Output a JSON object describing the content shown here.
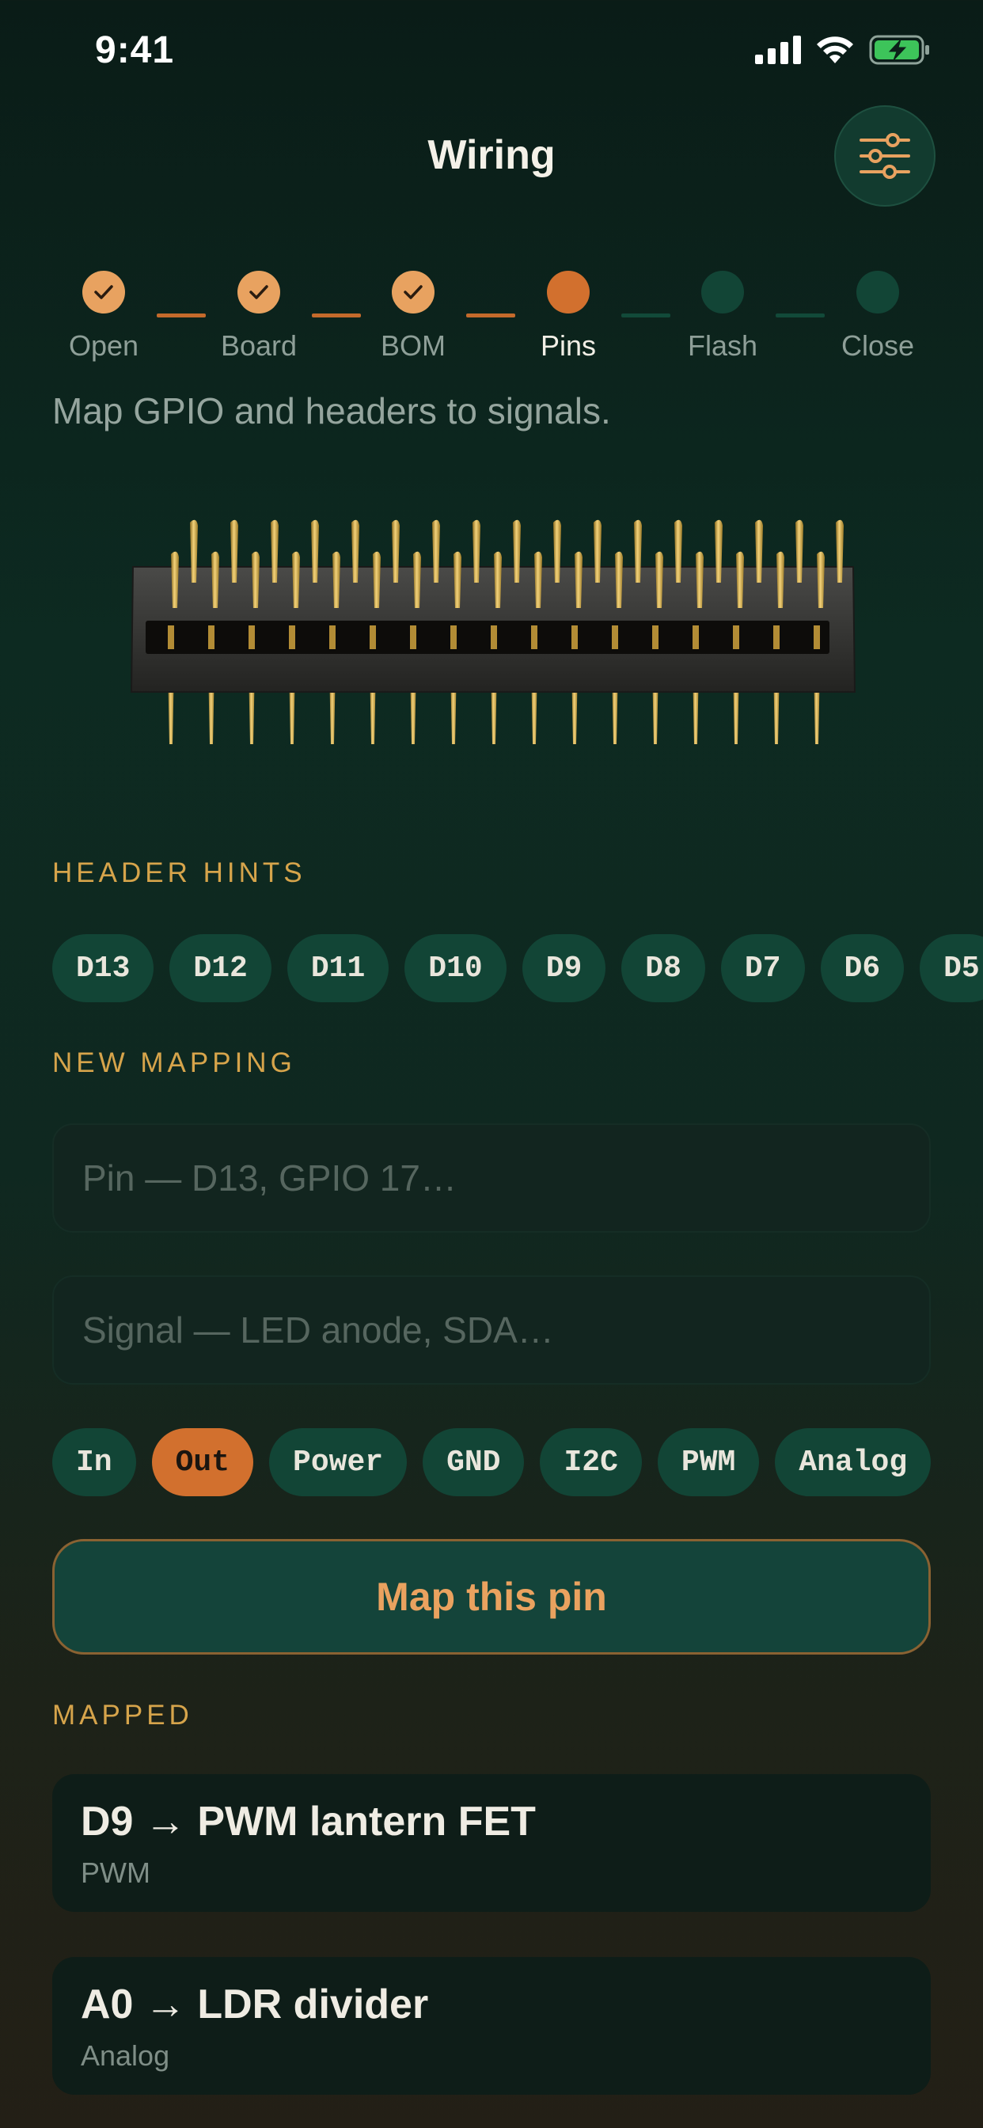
{
  "status_bar": {
    "time": "9:41",
    "icons": [
      "signal-icon",
      "wifi-icon",
      "battery-charging-icon"
    ]
  },
  "nav": {
    "title": "Wiring",
    "settings_icon": "sliders-icon"
  },
  "steps": [
    {
      "label": "Open",
      "state": "done"
    },
    {
      "label": "Board",
      "state": "done"
    },
    {
      "label": "BOM",
      "state": "done"
    },
    {
      "label": "Pins",
      "state": "current"
    },
    {
      "label": "Flash",
      "state": "todo"
    },
    {
      "label": "Close",
      "state": "todo"
    }
  ],
  "subtitle": "Map GPIO and headers to signals.",
  "header_hints": {
    "label": "HEADER HINTS",
    "chips": [
      "D13",
      "D12",
      "D11",
      "D10",
      "D9",
      "D8",
      "D7",
      "D6",
      "D5"
    ]
  },
  "new_mapping": {
    "label": "NEW MAPPING",
    "pin_placeholder": "Pin — D13, GPIO 17…",
    "signal_placeholder": "Signal — LED anode, SDA…",
    "types": [
      "In",
      "Out",
      "Power",
      "GND",
      "I2C",
      "PWM",
      "Analog"
    ],
    "selected_type": "Out",
    "button_label": "Map this pin"
  },
  "mapped": {
    "label": "MAPPED",
    "items": [
      {
        "title": "D9 → PWM lantern FET",
        "type": "PWM"
      },
      {
        "title": "A0 → LDR divider",
        "type": "Analog"
      }
    ]
  },
  "colors": {
    "accent": "#d2702e",
    "accent_light": "#e8a260",
    "chip_bg": "#124536",
    "section_label": "#d6a44b"
  }
}
